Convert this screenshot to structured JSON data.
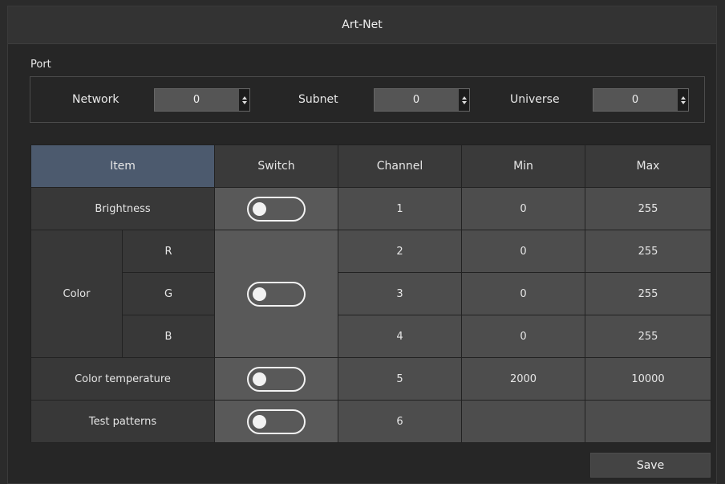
{
  "window": {
    "title": "Art-Net"
  },
  "port": {
    "label": "Port",
    "network": {
      "label": "Network",
      "value": "0"
    },
    "subnet": {
      "label": "Subnet",
      "value": "0"
    },
    "universe": {
      "label": "Universe",
      "value": "0"
    }
  },
  "table": {
    "headers": {
      "item": "Item",
      "switch": "Switch",
      "channel": "Channel",
      "min": "Min",
      "max": "Max"
    },
    "rows": {
      "brightness": {
        "label": "Brightness",
        "channel": "1",
        "min": "0",
        "max": "255",
        "switch_on": false
      },
      "color": {
        "label": "Color",
        "switch_on": false,
        "r": {
          "label": "R",
          "channel": "2",
          "min": "0",
          "max": "255"
        },
        "g": {
          "label": "G",
          "channel": "3",
          "min": "0",
          "max": "255"
        },
        "b": {
          "label": "B",
          "channel": "4",
          "min": "0",
          "max": "255"
        }
      },
      "color_temperature": {
        "label": "Color temperature",
        "channel": "5",
        "min": "2000",
        "max": "10000",
        "switch_on": false
      },
      "test_patterns": {
        "label": "Test patterns",
        "channel": "6",
        "min": "",
        "max": "",
        "switch_on": false
      }
    }
  },
  "actions": {
    "save_label": "Save"
  },
  "colors": {
    "header_item_bg": "#4c5a6e",
    "window_bg": "#262626"
  }
}
